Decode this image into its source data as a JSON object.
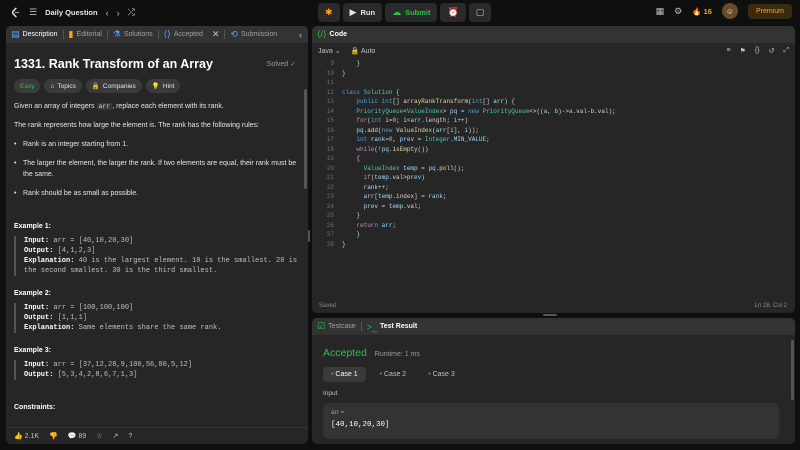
{
  "topbar": {
    "title": "Daily Question",
    "run_label": "Run",
    "submit_label": "Submit",
    "streak": "16",
    "premium_label": "Premium"
  },
  "left_tabs": [
    {
      "label": "Description"
    },
    {
      "label": "Editorial"
    },
    {
      "label": "Solutions"
    },
    {
      "label": "Accepted"
    },
    {
      "label": "Submission"
    }
  ],
  "problem": {
    "title": "1331. Rank Transform of an Array",
    "solved": "Solved",
    "difficulty": "Easy",
    "tags": [
      "Topics",
      "Companies",
      "Hint"
    ],
    "intro_a": "Given an array of integers ",
    "intro_code": "arr",
    "intro_b": ", replace each element with its rank.",
    "rank_rules": "The rank represents how large the element is. The rank has the following rules:",
    "rules": [
      "Rank is an integer starting from 1.",
      "The larger the element, the larger the rank. If two elements are equal, their rank must be the same.",
      "Rank should be as small as possible."
    ],
    "examples": [
      {
        "heading": "Example 1:",
        "input": "arr = [40,10,20,30]",
        "output": "[4,1,2,3]",
        "explanation": "40 is the largest element. 10 is the smallest. 20 is the second smallest. 30 is the third smallest."
      },
      {
        "heading": "Example 2:",
        "input": "arr = [100,100,100]",
        "output": "[1,1,1]",
        "explanation": "Same elements share the same rank."
      },
      {
        "heading": "Example 3:",
        "input": "arr = [37,12,28,9,100,56,80,5,12]",
        "output": "[5,3,4,2,8,6,7,1,3]"
      }
    ],
    "labels": {
      "input": "Input:",
      "output": "Output:",
      "explanation": "Explanation:"
    },
    "constraints": "Constraints:"
  },
  "left_footer": {
    "likes": "2.1K",
    "comments": "89"
  },
  "code": {
    "tab_label": "Code",
    "language": "Java",
    "mode": "Auto",
    "status": "Saved",
    "cursor": "Ln 28, Col 2",
    "line_numbers": [
      "9",
      "10",
      "11",
      "12",
      "13",
      "14",
      "15",
      "16",
      "17",
      "18",
      "19",
      "20",
      "21",
      "22",
      "23",
      "24",
      "25",
      "26",
      "27",
      "28"
    ]
  },
  "result": {
    "testcase_tab": "Testcase",
    "result_tab": "Test Result",
    "status": "Accepted",
    "runtime": "Runtime: 1 ms",
    "cases": [
      "Case 1",
      "Case 2",
      "Case 3"
    ],
    "input_label": "Input",
    "param_name": "arr =",
    "param_value": "[40,10,20,30]"
  }
}
